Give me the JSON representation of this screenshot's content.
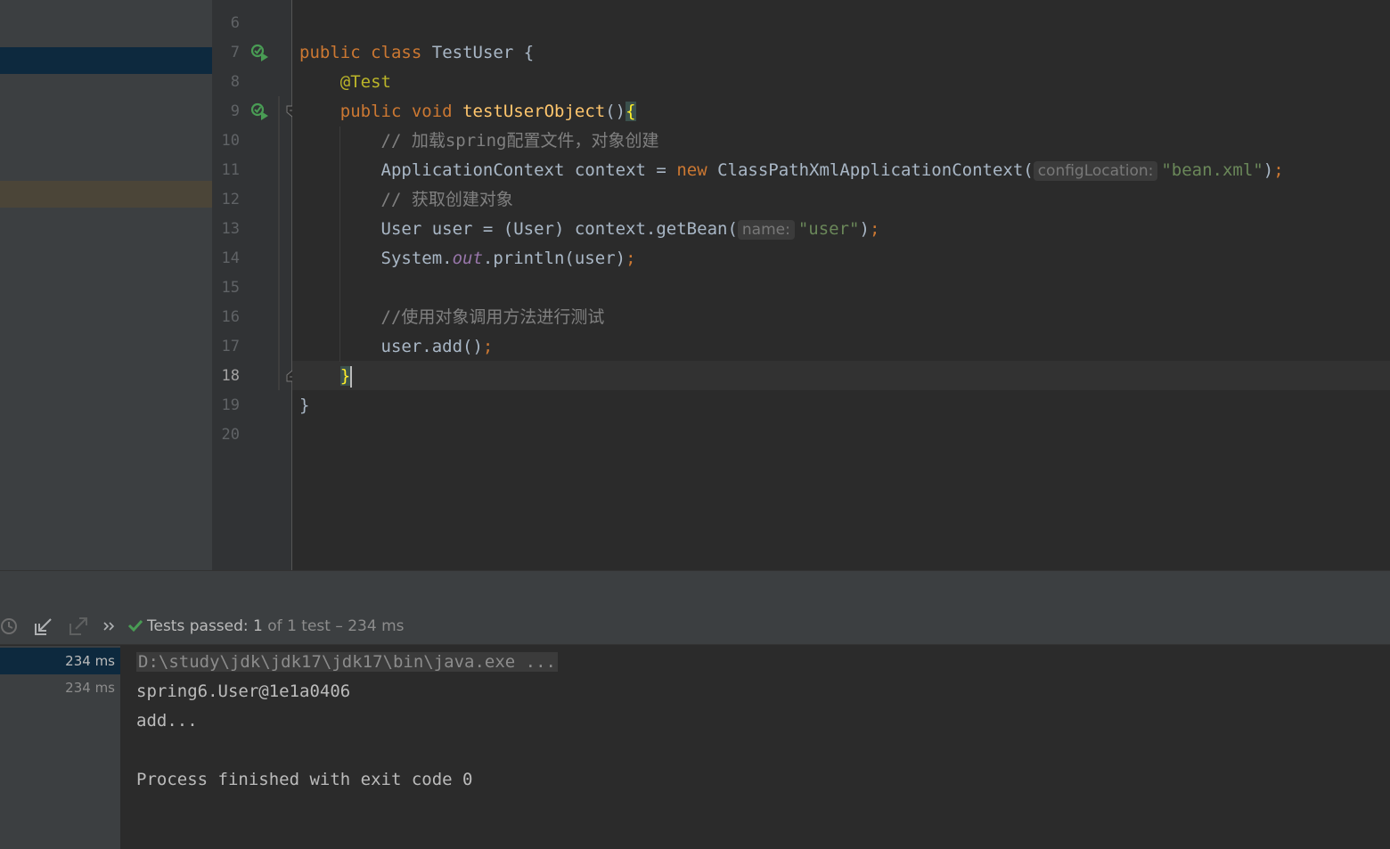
{
  "editor": {
    "line_numbers": [
      "6",
      "7",
      "8",
      "9",
      "10",
      "11",
      "12",
      "13",
      "14",
      "15",
      "16",
      "17",
      "18",
      "19",
      "20"
    ],
    "current_line": "18",
    "code": {
      "l7_public": "public",
      "l7_class": "class",
      "l7_name": "TestUser",
      "l7_brace": "{",
      "l8_annotation": "@Test",
      "l9_public": "public",
      "l9_void": "void",
      "l9_method": "testUserObject",
      "l9_parens": "()",
      "l9_brace": "{",
      "l10_comment": "// 加载spring配置文件，对象创建",
      "l11_type": "ApplicationContext",
      "l11_var": "context",
      "l11_eq": "=",
      "l11_new": "new",
      "l11_ctor": "ClassPathXmlApplicationContext(",
      "l11_hint": "configLocation:",
      "l11_arg": "\"bean.xml\"",
      "l11_close": ")",
      "l11_semi": ";",
      "l12_comment": "// 获取创建对象",
      "l13_pre": "User user = (User) context.getBean(",
      "l13_hint": "name:",
      "l13_arg": "\"user\"",
      "l13_close": ")",
      "l13_semi": ";",
      "l14_system": "System.",
      "l14_out": "out",
      "l14_rest": ".println(user)",
      "l14_semi": ";",
      "l16_comment": "//使用对象调用方法进行测试",
      "l17_call": "user.add()",
      "l17_semi": ";",
      "l18_brace": "}",
      "l19_brace": "}"
    }
  },
  "run_panel": {
    "status_label": "Tests passed:",
    "status_count": "1",
    "status_detail": "of 1 test – 234 ms",
    "test_tree": [
      "234 ms",
      "234 ms"
    ],
    "console": {
      "command": "D:\\study\\jdk\\jdk17\\jdk17\\bin\\java.exe ...",
      "line1": "spring6.User@1e1a0406",
      "line2": "add...",
      "line3": "Process finished with exit code 0"
    }
  },
  "icons": {
    "run_test": "run-test-icon",
    "fold": "fold-icon",
    "history": "test-history-icon",
    "import": "import-tests-icon",
    "export": "export-tests-icon",
    "more": "more-chevron-icon",
    "passed": "check-icon"
  },
  "colors": {
    "keyword": "#cc7832",
    "annotation": "#bbb529",
    "method": "#ffc66d",
    "string": "#6a8759",
    "comment": "#808080",
    "passed_green": "#499c54"
  }
}
